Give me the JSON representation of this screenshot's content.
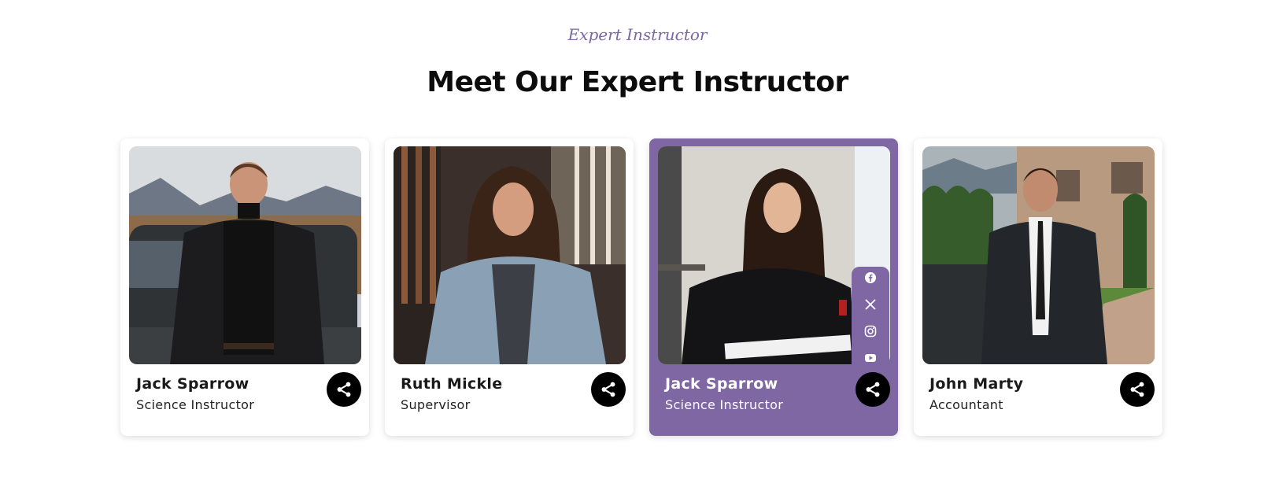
{
  "header": {
    "subtitle": "Expert Instructor",
    "title": "Meet Our Expert Instructor"
  },
  "colors": {
    "accent": "#7e67a3",
    "share_button": "#000000"
  },
  "instructors": [
    {
      "name": "Jack Sparrow",
      "role": "Science Instructor"
    },
    {
      "name": "Ruth Mickle",
      "role": "Supervisor"
    },
    {
      "name": "Jack Sparrow",
      "role": "Science Instructor",
      "active": true
    },
    {
      "name": "John Marty",
      "role": "Accountant"
    }
  ],
  "social_icons": [
    "facebook-icon",
    "x-icon",
    "instagram-icon",
    "youtube-icon"
  ]
}
